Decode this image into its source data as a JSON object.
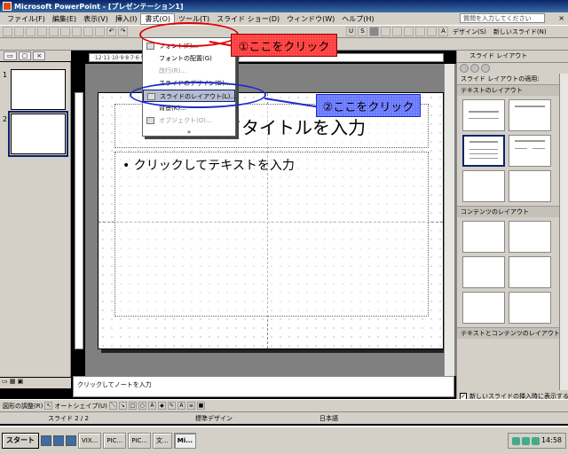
{
  "window": {
    "title": "Microsoft PowerPoint - [プレゼンテーション1]"
  },
  "menubar": {
    "items": [
      "ファイル(F)",
      "編集(E)",
      "表示(V)",
      "挿入(I)",
      "書式(O)",
      "ツール(T)",
      "スライド ショー(D)",
      "ウィンドウ(W)",
      "ヘルプ(H)"
    ],
    "help_placeholder": "質問を入力してください"
  },
  "toolbar": {
    "design_label": "デザイン(S)",
    "new_slide_label": "新しいスライド(N)"
  },
  "dropdown": {
    "items": [
      {
        "label": "フォント(F)...",
        "disabled": false
      },
      {
        "label": "フォントの配置(G)",
        "disabled": false
      },
      {
        "label": "改行(R)...",
        "disabled": true
      },
      {
        "label": "スライドのデザイン(D)...",
        "disabled": false
      },
      {
        "label": "スライドのレイアウト(L)...",
        "disabled": false
      },
      {
        "label": "背景(K)...",
        "disabled": false
      },
      {
        "label": "オブジェクト(O)...",
        "disabled": true
      }
    ]
  },
  "callouts": {
    "step1": "①ここをクリック",
    "step2": "②ここをクリック"
  },
  "thumbnails": [
    "1",
    "2"
  ],
  "slide": {
    "title_placeholder": "てタイトルを入力",
    "body_placeholder": "• クリックしてテキストを入力"
  },
  "notes": {
    "placeholder": "クリックしてノートを入力"
  },
  "task_pane": {
    "title": "スライド レイアウト",
    "apply_label": "スライド レイアウトの適用:",
    "section_text": "テキストのレイアウト",
    "section_content": "コンテンツのレイアウト",
    "section_text_content": "テキストとコンテンツのレイアウト",
    "show_on_insert": "新しいスライドの挿入時に表示する"
  },
  "drawbar": {
    "draw_label": "図形の調整(R)",
    "autoshape_label": "オートシェイプ(U)"
  },
  "status": {
    "slide": "スライド 2 / 2",
    "design": "標準デザイン",
    "language": "日本語"
  },
  "taskbar": {
    "start_label": "スタート",
    "buttons": [
      "VIX...",
      "PIC...",
      "PIC...",
      "文...",
      "Mi..."
    ],
    "clock": "14:58"
  }
}
